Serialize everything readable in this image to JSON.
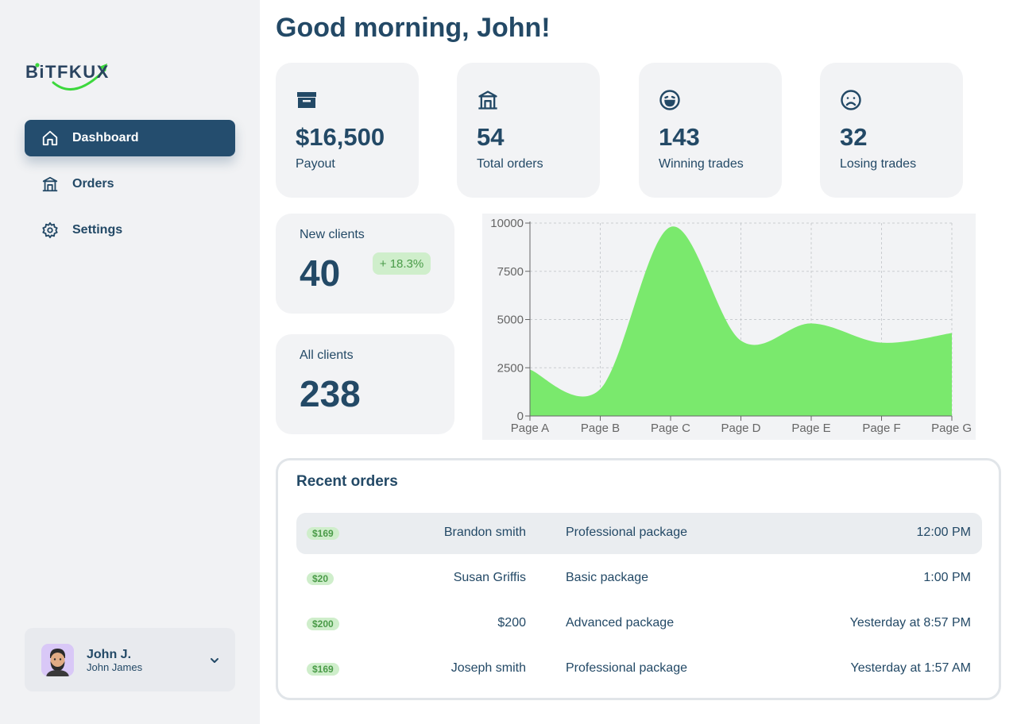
{
  "brand": {
    "name": "BiTFKUX",
    "accent": "#3dd83d"
  },
  "greeting": "Good morning, John!",
  "sidebar": {
    "items": [
      {
        "label": "Dashboard",
        "icon": "home-icon",
        "active": true
      },
      {
        "label": "Orders",
        "icon": "building-icon",
        "active": false
      },
      {
        "label": "Settings",
        "icon": "gear-icon",
        "active": false
      }
    ],
    "user": {
      "name": "John J.",
      "full_name": "John James",
      "avatar": "bearded-man-avatar"
    }
  },
  "stats": [
    {
      "value": "$16,500",
      "label": "Payout",
      "icon": "archive-icon"
    },
    {
      "value": "54",
      "label": "Total orders",
      "icon": "building-icon"
    },
    {
      "value": "143",
      "label": "Winning trades",
      "icon": "laughing-face-icon"
    },
    {
      "value": "32",
      "label": "Losing trades",
      "icon": "sad-face-icon"
    }
  ],
  "clients": {
    "new": {
      "label": "New clients",
      "value": "40",
      "change": "+ 18.3%"
    },
    "all": {
      "label": "All clients",
      "value": "238"
    }
  },
  "chart_data": {
    "type": "area",
    "categories": [
      "Page A",
      "Page B",
      "Page C",
      "Page D",
      "Page E",
      "Page F",
      "Page G"
    ],
    "values": [
      2400,
      1398,
      9800,
      3908,
      4800,
      3800,
      4300
    ],
    "ylim": [
      0,
      10000
    ],
    "yticks": [
      0,
      2500,
      5000,
      7500,
      10000
    ],
    "grid": true,
    "fill_color": "#7ae96d",
    "title": "",
    "xlabel": "",
    "ylabel": ""
  },
  "orders": {
    "title": "Recent orders",
    "rows": [
      {
        "price": "$169",
        "name": "Brandon smith",
        "package": "Professional package",
        "time": "12:00 PM",
        "highlight": true
      },
      {
        "price": "$20",
        "name": "Susan Griffis",
        "package": "Basic package",
        "time": "1:00 PM",
        "highlight": false
      },
      {
        "price": "$200",
        "name": "$200",
        "package": "Advanced package",
        "time": "Yesterday at 8:57 PM",
        "highlight": false
      },
      {
        "price": "$169",
        "name": "Joseph smith",
        "package": "Professional package",
        "time": "Yesterday at 1:57 AM",
        "highlight": false
      }
    ]
  }
}
